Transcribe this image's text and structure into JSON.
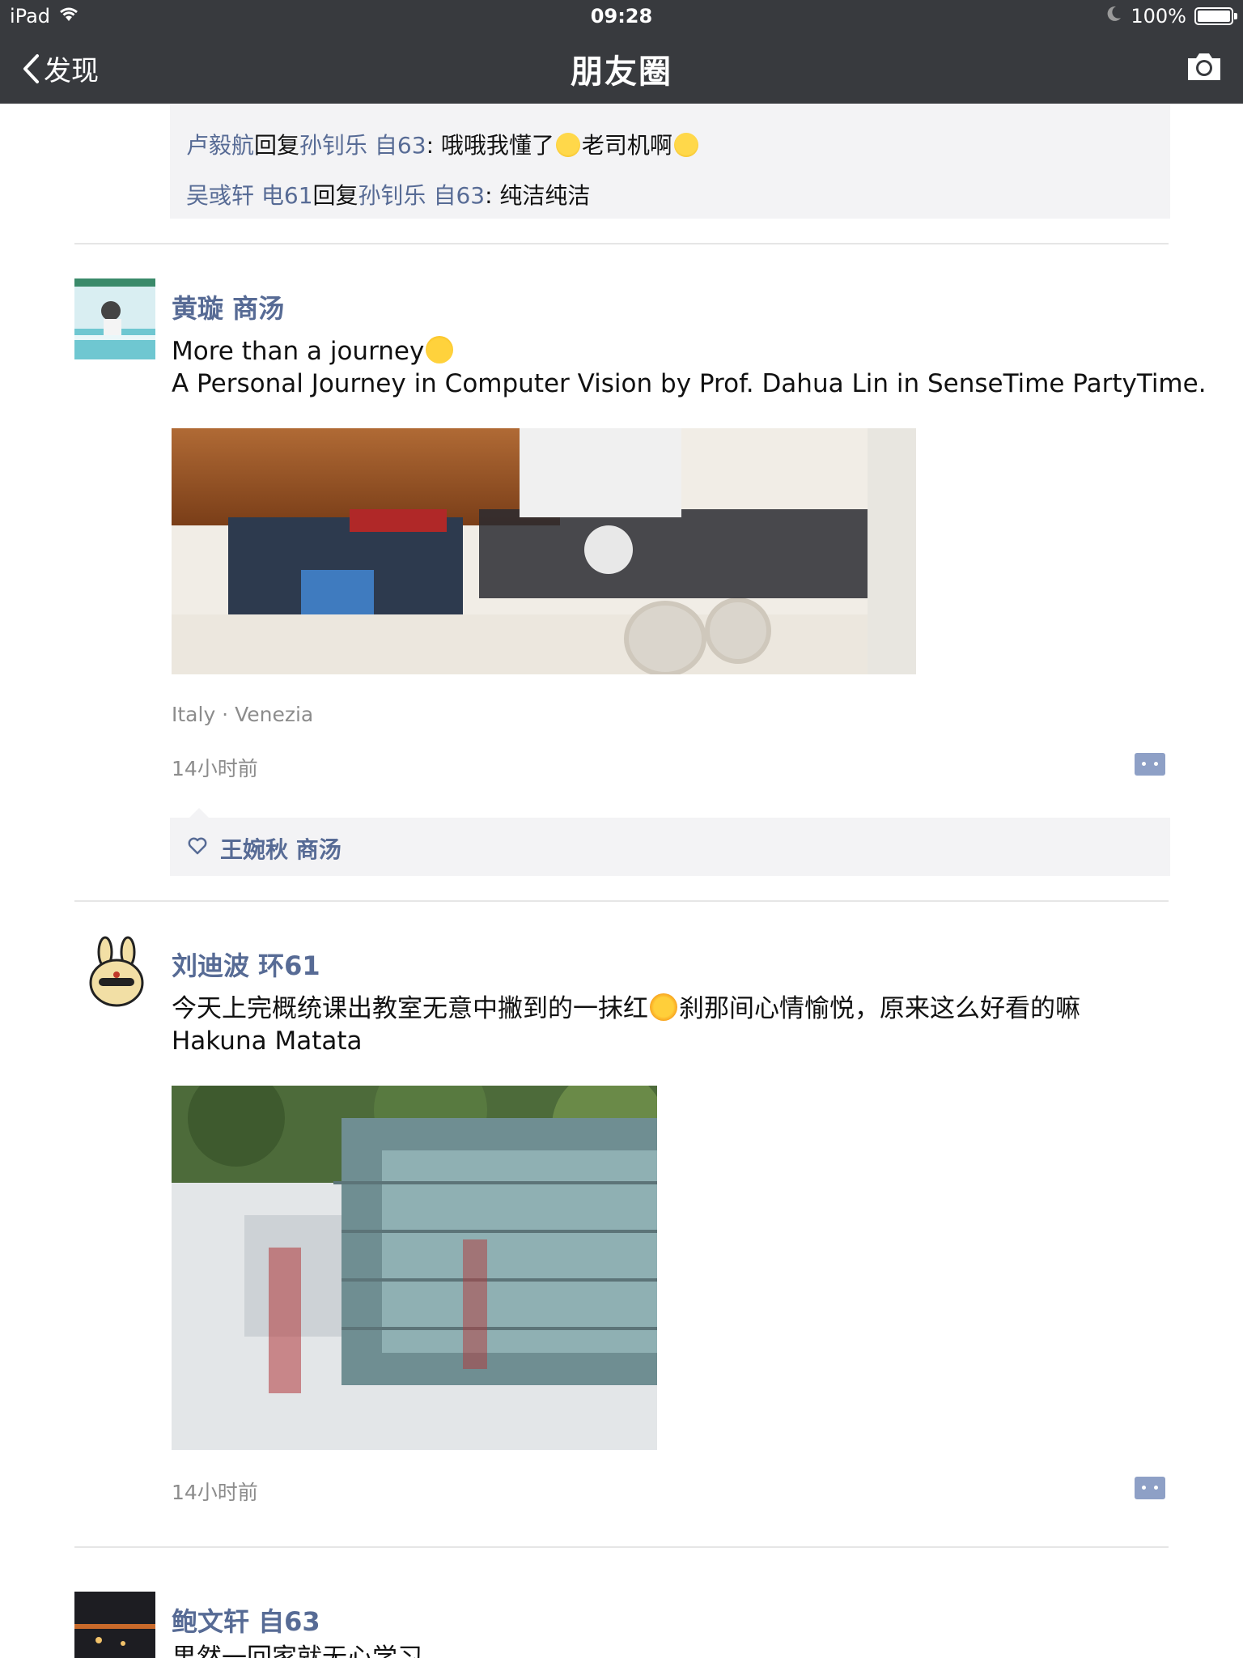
{
  "status_bar": {
    "device": "iPad",
    "time": "09:28",
    "battery": "100%",
    "battery_level": 1.0
  },
  "nav": {
    "back_label": "发现",
    "title": "朋友圈"
  },
  "prev_post": {
    "comments": [
      {
        "from": "卢毅航",
        "connector": "回复",
        "to": "孙钊乐 自63",
        "text_a": ": 哦哦我懂了",
        "text_b": "老司机啊"
      },
      {
        "from": "吴彧轩 电61",
        "connector": "回复",
        "to": "孙钊乐 自63",
        "text": ": 纯洁纯洁"
      }
    ]
  },
  "posts": [
    {
      "author": "黄璇 商汤",
      "text_line1": "More than a journey",
      "text_line2": "A Personal Journey in Computer Vision by Prof. Dahua Lin in SenseTime PartyTime.",
      "location": "Italy · Venezia",
      "time": "14小时前",
      "likes": "王婉秋 商汤"
    },
    {
      "author": "刘迪波 环61",
      "text_line1_a": "今天上完概统课出教室无意中撇到的一抹红",
      "text_line1_b": "刹那间心情愉悦，原来这么好看的嘛",
      "text_line2": "Hakuna Matata",
      "time": "14小时前"
    },
    {
      "author": "鲍文轩 自63",
      "text_line1": "果然一回家就无心学习"
    }
  ],
  "icons": [
    "back-chevron-icon",
    "camera-icon",
    "wifi-icon",
    "moon-icon",
    "battery-icon",
    "heart-icon",
    "comment-more-icon"
  ],
  "colors": {
    "bar": "#383a3e",
    "name_link": "#576b95",
    "comment_bg": "#f3f3f5",
    "meta_gray": "#8c8c8c"
  }
}
